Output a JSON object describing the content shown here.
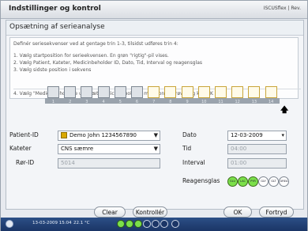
{
  "window": {
    "title": "Indstillinger og kontrol",
    "logo": "ISCUSflex | Rev."
  },
  "page": {
    "heading": "Opsætning af serieanalyse"
  },
  "instructions": {
    "line1": "Definér seriesekvenser ved at gentage trin 1-3, tilsidst udføres trin 4:",
    "line2": "1. Vælg startposition for serieekvensen. En grøn \"rigtig\"-pil vises.",
    "line3": "2. Vælg Patient, Kateter, Medicinbeholder ID, Dato, Tid, Interval og reagensglas",
    "line4": "3. Vælg sidste position i sekvens",
    "line5": "4. Vælg \"Medicinbeholdere ud, isæt medicinbeholdere med kontrolprøver og klik OK"
  },
  "rack": {
    "positions": [
      "1",
      "2",
      "3",
      "4",
      "5",
      "6",
      "7",
      "8",
      "9",
      "10",
      "11",
      "12",
      "13",
      "14"
    ],
    "selected_from": 7,
    "arrow": "🡅"
  },
  "form": {
    "patient_label": "Patient-ID",
    "patient_value": "Demo John 1234567890",
    "kateter_label": "Kateter",
    "kateter_value": "CNS sæmre",
    "ror_label": "Rør-ID",
    "ror_value": "5014",
    "dato_label": "Dato",
    "dato_value": "12-03-2009",
    "tid_label": "Tid",
    "tid_value": "04:00",
    "interval_label": "Interval",
    "interval_value": "01:00",
    "reagens_label": "Reagensglas",
    "dropdown_glyph": "▼",
    "date_glyph": "▾"
  },
  "reagents": [
    {
      "label": "GLU",
      "on": true
    },
    {
      "label": "LAC",
      "on": true
    },
    {
      "label": "PYR",
      "on": true
    },
    {
      "label": "GLY",
      "on": false
    },
    {
      "label": "GLT",
      "on": false
    },
    {
      "label": "UREA",
      "on": false
    }
  ],
  "buttons": {
    "clear": "Clear",
    "kontroller": "Kontrollér",
    "ok": "OK",
    "fortryd": "Fortryd"
  },
  "status": {
    "datetime": "13-03-2009 15:04",
    "temp": "22.1 °C"
  },
  "colors": {
    "accent": "#1b3566",
    "reagent_on": "#7be04a",
    "selected_slot": "#c9a53a"
  }
}
